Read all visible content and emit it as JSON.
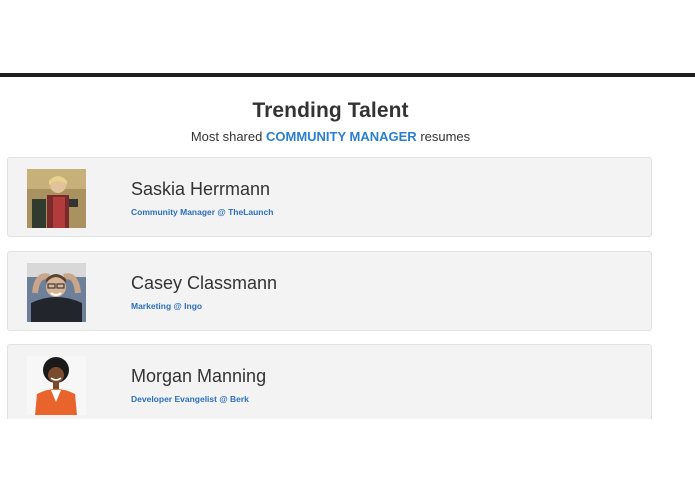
{
  "section": {
    "title": "Trending Talent",
    "subtitle_prefix": "Most shared",
    "subtitle_highlight": "COMMUNITY MANAGER",
    "subtitle_suffix": "resumes"
  },
  "profiles": [
    {
      "name": "Saskia Herrmann",
      "role": "Community Manager @ TheLaunch",
      "avatar_icon": "person-photo-icon"
    },
    {
      "name": "Casey Classmann",
      "role": "Marketing @ Ingo",
      "avatar_icon": "person-photo-icon"
    },
    {
      "name": "Morgan Manning",
      "role": "Developer Evangelist @ Berk",
      "avatar_icon": "person-photo-icon"
    }
  ],
  "colors": {
    "accent": "#2a7fd0",
    "heading": "#333333",
    "card_bg": "#f3f3f3",
    "rule": "#1f1f1f"
  }
}
